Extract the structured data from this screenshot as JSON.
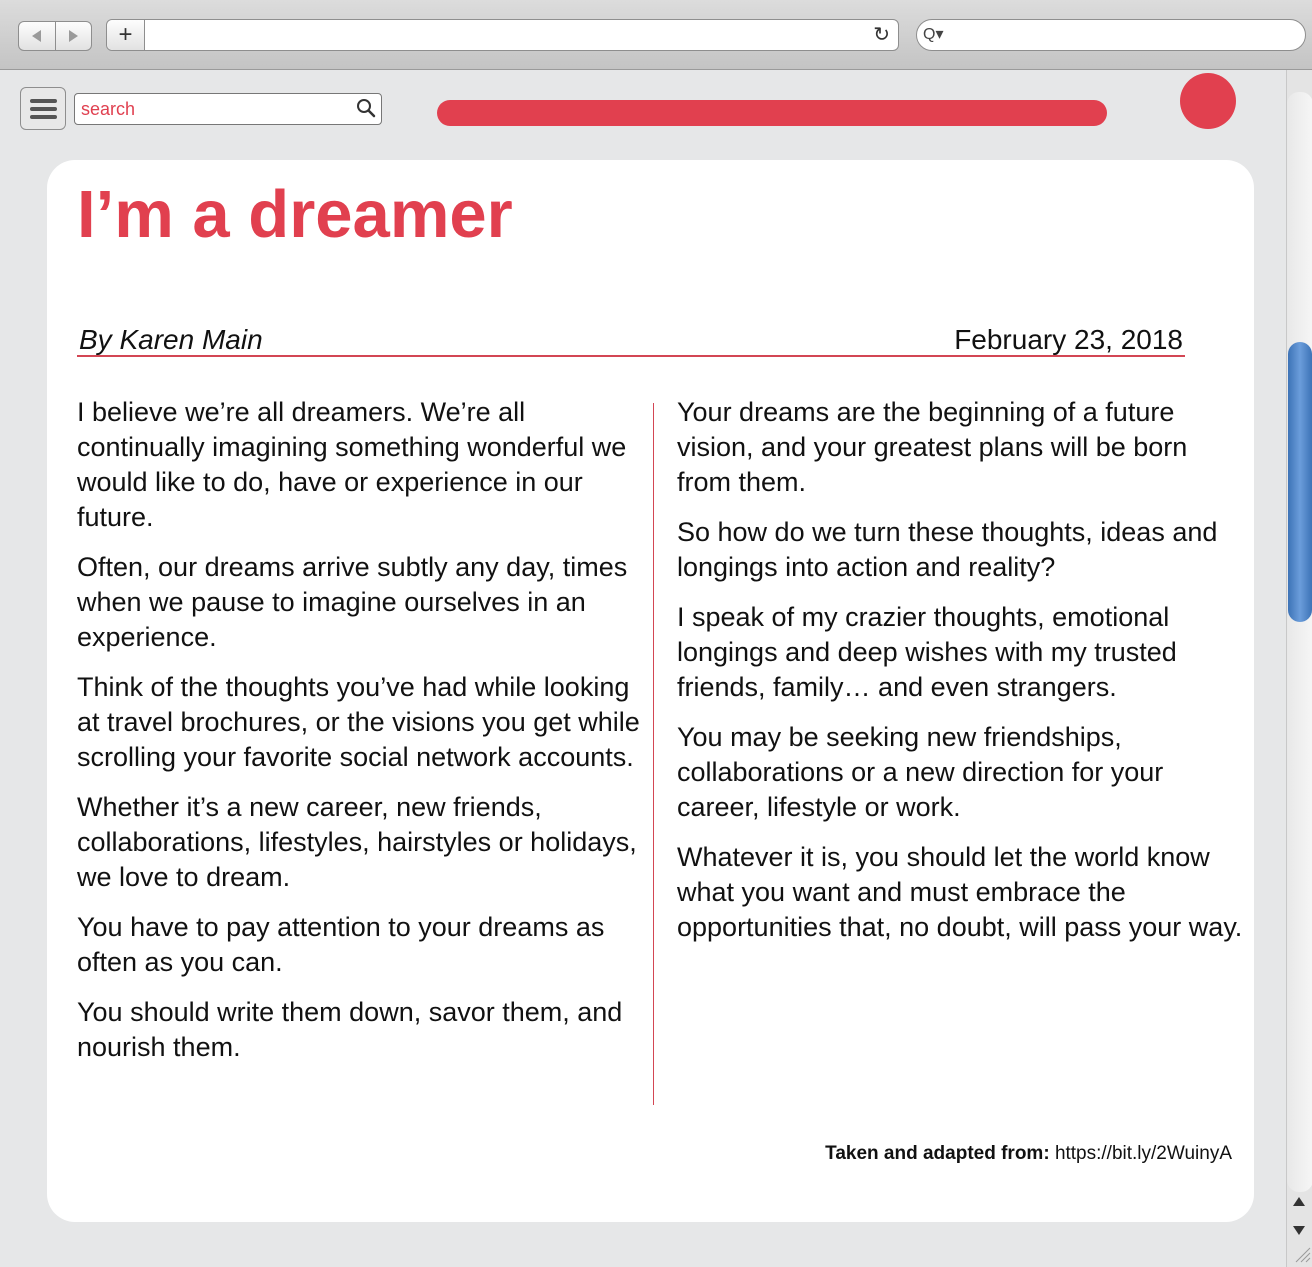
{
  "browser": {
    "new_tab_label": "+",
    "reload_glyph": "↻",
    "search_glyph": "Q▾"
  },
  "toolbar": {
    "search_placeholder": "search",
    "progress_percent": 100,
    "accent_color": "#e1404f"
  },
  "article": {
    "title": "I’m a dreamer",
    "author": "By Karen Main",
    "date": "February 23, 2018",
    "left_paragraphs": [
      "I believe we’re all dreamers. We’re all continually imagining something wonderful we would like to do, have or experience in our future.",
      "Often, our dreams arrive subtly any day, times when we pause to imagine ourselves in an experience.",
      "Think of the thoughts you’ve had while looking at travel brochures, or the visions you get while scrolling your favorite social network accounts.",
      "Whether it’s a new career, new friends, collaborations, lifestyles, hairstyles or holidays, we love to dream.",
      "You have to pay attention to your dreams as often as you can.",
      "You should write them down, savor them, and nourish them."
    ],
    "right_paragraphs": [
      "Your dreams are the beginning of a future vision, and your greatest plans will be born from them.",
      "So how do we turn these thoughts, ideas and longings into action and reality?",
      "I speak of my crazier thoughts, emotional longings and deep wishes with my trusted friends, family… and even strangers.",
      "You may be seeking new friendships, collaborations or a new direction for your career, lifestyle or work.",
      "Whatever it is, you should let the world know what you want and must embrace the opportunities that, no doubt, will pass your way."
    ],
    "credit_label": "Taken and adapted from:",
    "credit_url": "https://bit.ly/2WuinyA"
  },
  "icons": {
    "back": "back-arrow-icon",
    "forward": "forward-arrow-icon",
    "menu": "hamburger-menu-icon",
    "search": "search-icon",
    "reload": "reload-icon"
  }
}
